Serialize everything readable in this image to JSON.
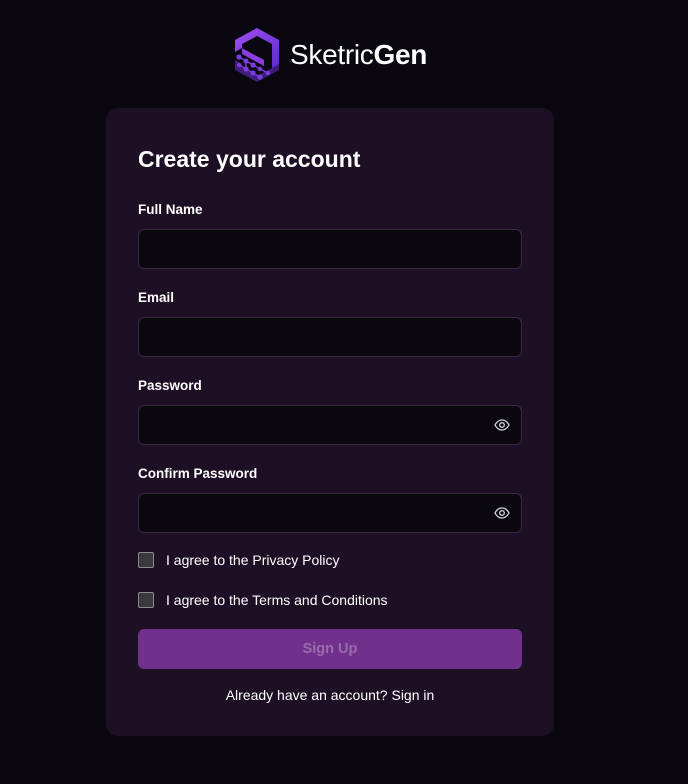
{
  "brand": {
    "name_light": "Sketric",
    "name_bold": "Gen",
    "logo_icon": "hex-network-logo-icon",
    "accent_colors": [
      "#5b2bd0",
      "#8a3ce0",
      "#b05ef0"
    ]
  },
  "form": {
    "title": "Create your account",
    "fields": {
      "full_name": {
        "label": "Full Name",
        "value": "",
        "placeholder": ""
      },
      "email": {
        "label": "Email",
        "value": "",
        "placeholder": ""
      },
      "password": {
        "label": "Password",
        "value": "",
        "placeholder": "",
        "toggle_icon": "eye-icon"
      },
      "confirm_password": {
        "label": "Confirm Password",
        "value": "",
        "placeholder": "",
        "toggle_icon": "eye-icon"
      }
    },
    "agreements": {
      "privacy": {
        "label": "I agree to the Privacy Policy",
        "checked": false
      },
      "terms": {
        "label": "I agree to the Terms and Conditions",
        "checked": false
      }
    },
    "submit_label": "Sign Up",
    "submit_color": "#70308c",
    "signin_prompt": "Already have an account?",
    "signin_link": "Sign in"
  },
  "colors": {
    "page_background": "#0b0710",
    "card_background": "#1d0f24",
    "input_background": "#0b070e",
    "input_border": "#3a2a40"
  }
}
